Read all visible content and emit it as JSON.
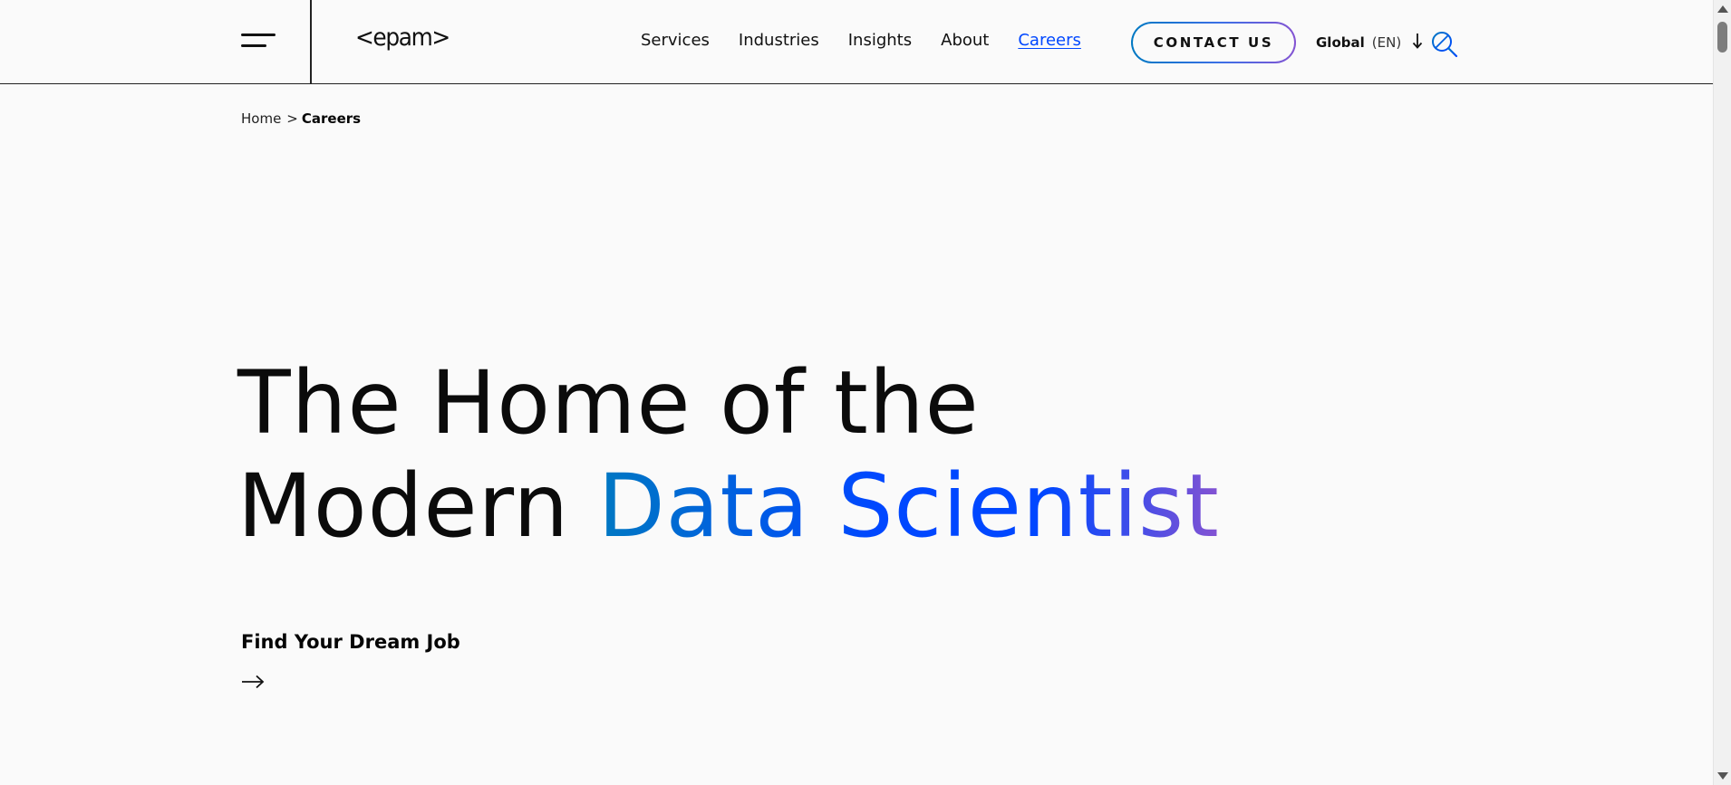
{
  "header": {
    "logo_text": "<epam>",
    "nav": {
      "services": "Services",
      "industries": "Industries",
      "insights": "Insights",
      "about": "About",
      "careers": "Careers"
    },
    "contact_label": "CONTACT US",
    "region": "Global",
    "language": "(EN)",
    "active_nav": "Careers",
    "accent_color": "#0047ff"
  },
  "breadcrumb": {
    "home": "Home",
    "separator": ">",
    "current": "Careers"
  },
  "hero": {
    "line1": "The Home of the",
    "line2_plain": "Modern ",
    "line2_highlight": "Data Scientist",
    "gradient_colors": [
      "#0078c2",
      "#0047ff",
      "#8453d2"
    ]
  },
  "cta": {
    "label": "Find Your Dream Job",
    "icon": "arrow-right-icon"
  },
  "icons": {
    "menu": "hamburger-menu-icon",
    "language_arrow": "arrow-down-icon",
    "search": "search-icon"
  }
}
